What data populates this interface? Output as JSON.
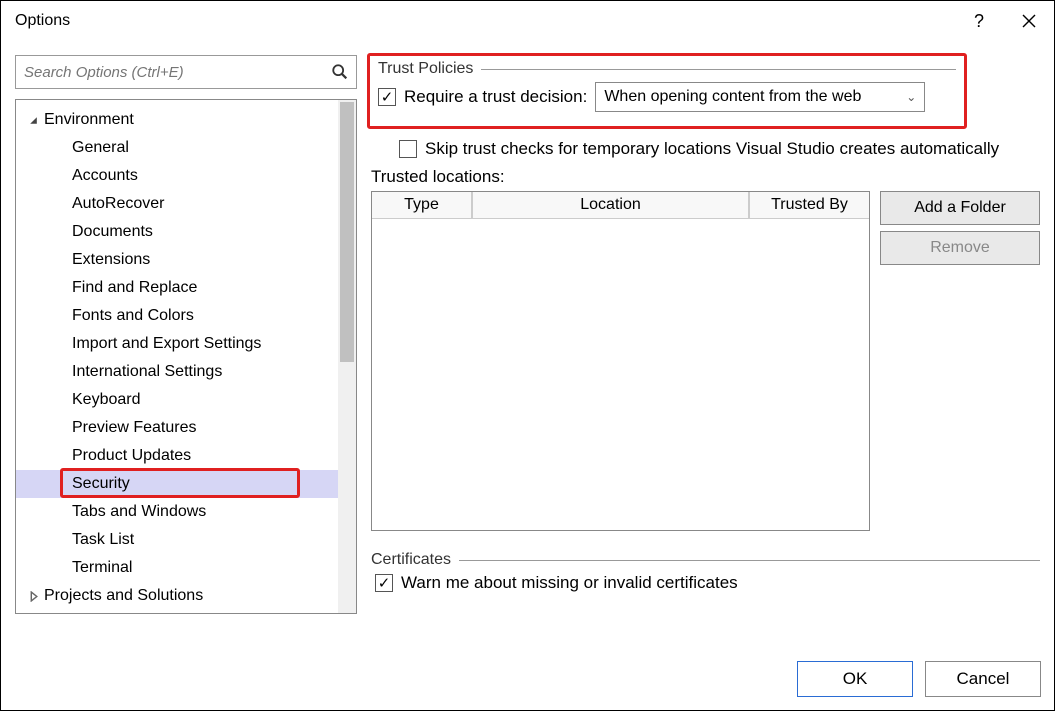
{
  "window": {
    "title": "Options"
  },
  "search": {
    "placeholder": "Search Options (Ctrl+E)"
  },
  "tree": {
    "items": [
      {
        "label": "Environment",
        "depth": 1,
        "expander": "▲"
      },
      {
        "label": "General",
        "depth": 2
      },
      {
        "label": "Accounts",
        "depth": 2
      },
      {
        "label": "AutoRecover",
        "depth": 2
      },
      {
        "label": "Documents",
        "depth": 2
      },
      {
        "label": "Extensions",
        "depth": 2
      },
      {
        "label": "Find and Replace",
        "depth": 2
      },
      {
        "label": "Fonts and Colors",
        "depth": 2
      },
      {
        "label": "Import and Export Settings",
        "depth": 2
      },
      {
        "label": "International Settings",
        "depth": 2
      },
      {
        "label": "Keyboard",
        "depth": 2
      },
      {
        "label": "Preview Features",
        "depth": 2
      },
      {
        "label": "Product Updates",
        "depth": 2
      },
      {
        "label": "Security",
        "depth": 2,
        "selected": true
      },
      {
        "label": "Tabs and Windows",
        "depth": 2
      },
      {
        "label": "Task List",
        "depth": 2
      },
      {
        "label": "Terminal",
        "depth": 2
      },
      {
        "label": "Projects and Solutions",
        "depth": 1,
        "expander": "▷"
      }
    ]
  },
  "trust": {
    "section_label": "Trust Policies",
    "require_label": "Require a trust decision:",
    "combo_value": "When opening content from the web",
    "skip_label": "Skip trust checks for temporary locations Visual Studio creates automatically",
    "locations_label": "Trusted locations:",
    "columns": {
      "c1": "Type",
      "c2": "Location",
      "c3": "Trusted By"
    },
    "add_folder": "Add a Folder",
    "remove": "Remove"
  },
  "certs": {
    "section_label": "Certificates",
    "warn_label": "Warn me about missing or invalid certificates"
  },
  "buttons": {
    "ok": "OK",
    "cancel": "Cancel"
  }
}
